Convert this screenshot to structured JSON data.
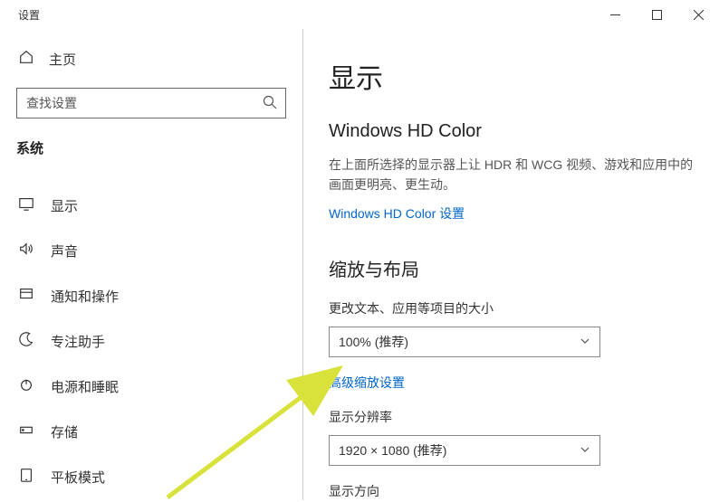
{
  "titlebar": {
    "title": "设置"
  },
  "sidebar": {
    "home": "主页",
    "search_placeholder": "查找设置",
    "category": "系统",
    "items": [
      {
        "label": "显示"
      },
      {
        "label": "声音"
      },
      {
        "label": "通知和操作"
      },
      {
        "label": "专注助手"
      },
      {
        "label": "电源和睡眠"
      },
      {
        "label": "存储"
      },
      {
        "label": "平板模式"
      }
    ]
  },
  "content": {
    "page_title": "显示",
    "hd_section": {
      "title": "Windows HD Color",
      "desc": "在上面所选择的显示器上让 HDR 和 WCG 视频、游戏和应用中的画面更明亮、更生动。",
      "link": "Windows HD Color 设置"
    },
    "scaling_section": {
      "title": "缩放与布局",
      "scale_label": "更改文本、应用等项目的大小",
      "scale_value": "100% (推荐)",
      "advanced_link": "高级缩放设置",
      "resolution_label": "显示分辨率",
      "resolution_value": "1920 × 1080 (推荐)",
      "orientation_label": "显示方向"
    }
  }
}
